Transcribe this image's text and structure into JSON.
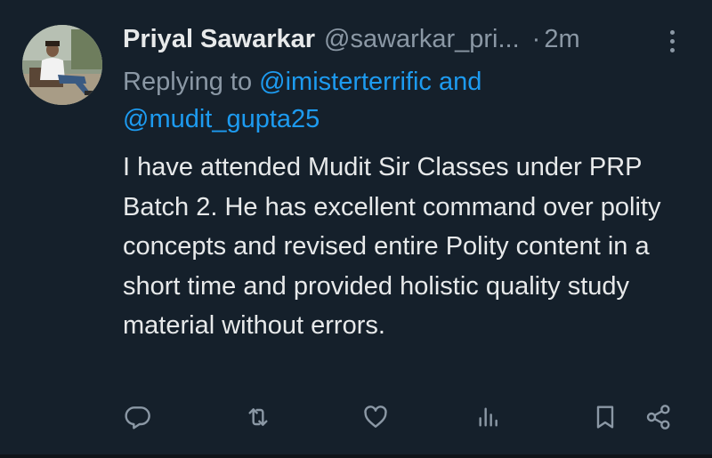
{
  "tweet": {
    "display_name": "Priyal Sawarkar",
    "handle": "@sawarkar_pri...",
    "separator": "·",
    "time": "2m",
    "reply_prefix": "Replying to",
    "mention_1": "@imisterterrific",
    "reply_joiner": "and",
    "mention_2": "@mudit_gupta25",
    "text": "I have attended Mudit Sir Classes under PRP Batch 2. He has excellent command over polity concepts and revised entire Polity content in a short time and provided holistic quality study material without errors."
  },
  "actions": {
    "icons": [
      "reply-icon",
      "retweet-icon",
      "like-icon",
      "views-icon",
      "bookmark-icon",
      "share-icon"
    ]
  },
  "colors": {
    "background": "#15202b",
    "primary_text": "#e7e9ea",
    "secondary_text": "#8b98a5",
    "accent": "#1d9bf0"
  }
}
